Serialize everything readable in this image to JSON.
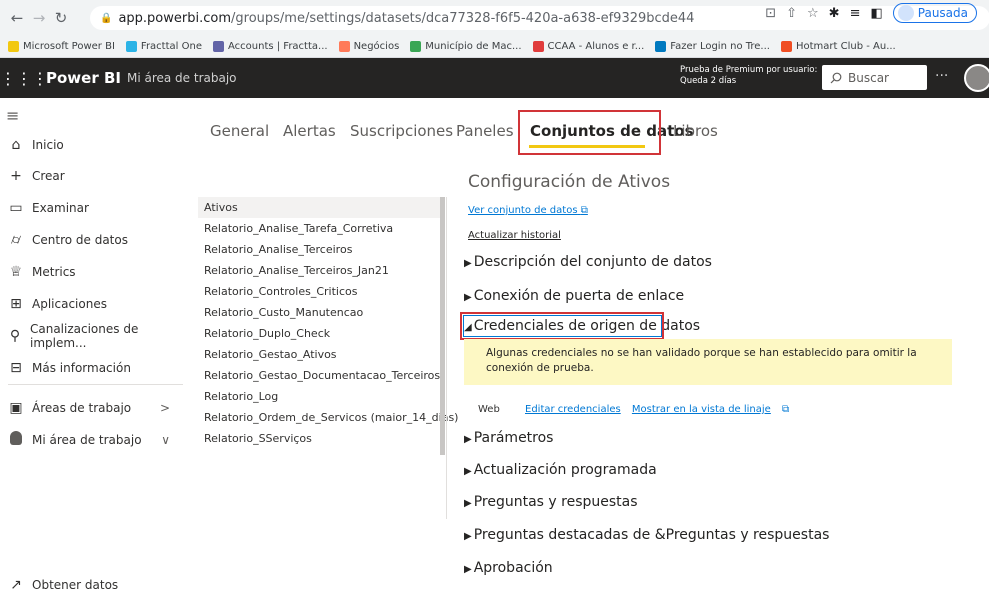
{
  "browser": {
    "url_host": "app.powerbi.com",
    "url_path": "/groups/me/settings/datasets/dca77328-f6f5-420a-a638-ef9329bcde44",
    "profile_status": "Pausada",
    "bookmarks": [
      {
        "label": "Microsoft Power BI",
        "color": "#f2c811"
      },
      {
        "label": "Fracttal One",
        "color": "#2bb3e6"
      },
      {
        "label": "Accounts | Fractta...",
        "color": "#6264a7"
      },
      {
        "label": "Negócios",
        "color": "#ff7a59"
      },
      {
        "label": "Município de Mac...",
        "color": "#3aa655"
      },
      {
        "label": "CCAA - Alunos e r...",
        "color": "#e03c3c"
      },
      {
        "label": "Fazer Login no Tre...",
        "color": "#0079bf"
      },
      {
        "label": "Hotmart Club - Au...",
        "color": "#f04e23"
      }
    ]
  },
  "header": {
    "brand": "Power BI",
    "workspace": "Mi área de trabajo",
    "trial_line1": "Prueba de Premium por usuario:",
    "trial_line2": "Queda 2 días",
    "search_placeholder": "Buscar",
    "more": "···"
  },
  "sidebar": {
    "items": [
      {
        "label": "Inicio",
        "icon": "⌂"
      },
      {
        "label": "Crear",
        "icon": "+"
      },
      {
        "label": "Examinar",
        "icon": "▭"
      },
      {
        "label": "Centro de datos",
        "icon": "⌭"
      },
      {
        "label": "Metrics",
        "icon": "♕"
      },
      {
        "label": "Aplicaciones",
        "icon": "⊞"
      },
      {
        "label": "Canalizaciones de implem...",
        "icon": "⚲"
      },
      {
        "label": "Más información",
        "icon": "⊟"
      }
    ],
    "workspaces": {
      "label": "Áreas de trabajo",
      "icon": "▣",
      "chevron": ">"
    },
    "my_workspace": {
      "label": "Mi área de trabajo",
      "chevron": "∨"
    },
    "get_data": {
      "label": "Obtener datos",
      "icon": "↗"
    }
  },
  "tabs": [
    {
      "label": "General"
    },
    {
      "label": "Alertas"
    },
    {
      "label": "Suscripciones"
    },
    {
      "label": "Paneles"
    },
    {
      "label": "Conjuntos de datos"
    },
    {
      "label": "Libros"
    }
  ],
  "datasets": [
    "Ativos",
    "Relatorio_Analise_Tarefa_Corretiva",
    "Relatorio_Analise_Terceiros",
    "Relatorio_Analise_Terceiros_Jan21",
    "Relatorio_Controles_Criticos",
    "Relatorio_Custo_Manutencao",
    "Relatorio_Duplo_Check",
    "Relatorio_Gestao_Ativos",
    "Relatorio_Gestao_Documentacao_Terceiros",
    "Relatorio_Log",
    "Relatorio_Ordem_de_Servicos (maior_14_dias)",
    "Relatorio_SServiços"
  ],
  "settings": {
    "title": "Configuración de Ativos",
    "view_dataset": "Ver conjunto de datos",
    "refresh_history": "Actualizar historial",
    "sections": [
      "Descripción del conjunto de datos",
      "Conexión de puerta de enlace",
      "Credenciales de origen de datos",
      "Parámetros",
      "Actualización programada",
      "Preguntas y respuestas",
      "Preguntas destacadas de &Preguntas y respuestas",
      "Aprobación"
    ],
    "warning": "Algunas credenciales no se han validado porque se han establecido para omitir la conexión de prueba.",
    "web_label": "Web",
    "edit_credentials": "Editar credenciales",
    "show_lineage": "Mostrar en la vista de linaje"
  }
}
